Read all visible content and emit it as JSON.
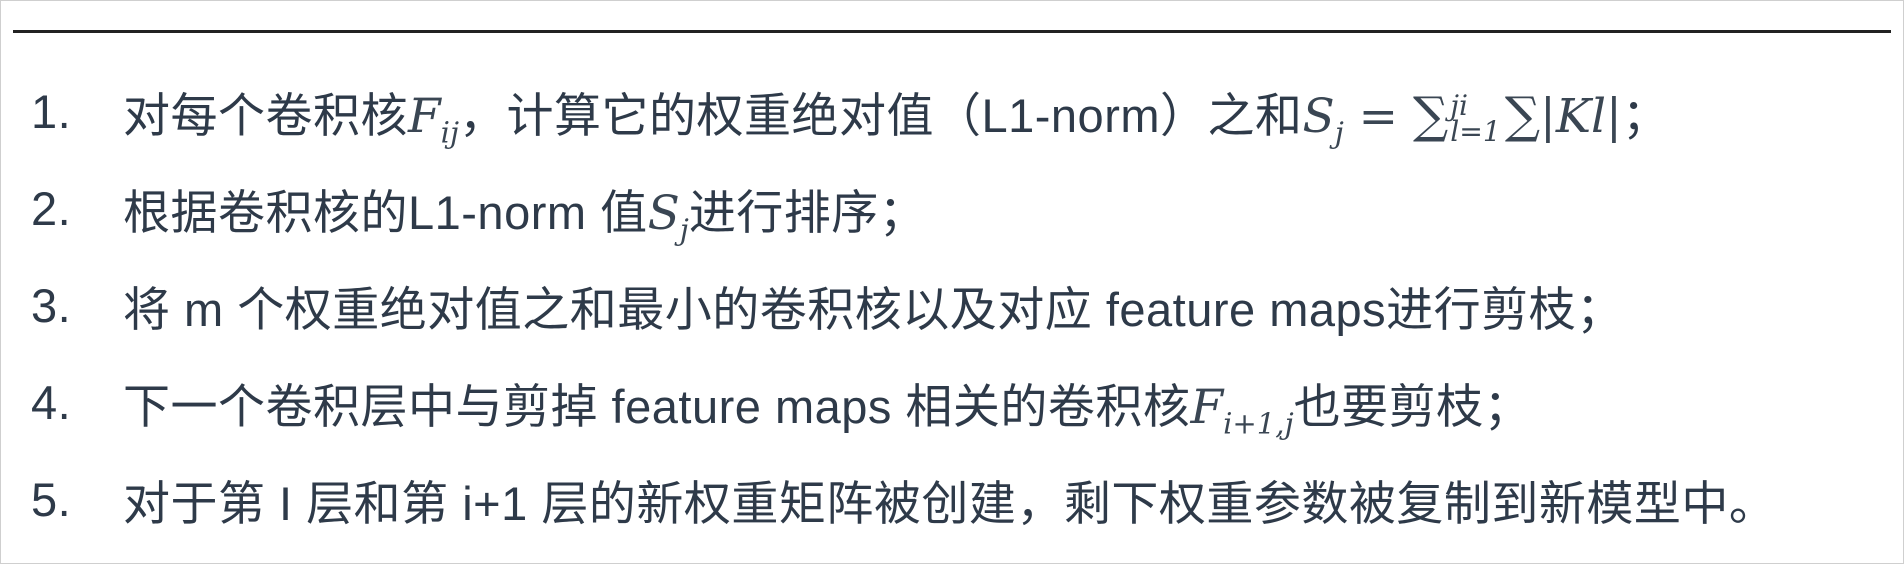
{
  "steps": [
    {
      "number": "1.",
      "text_a": "对每个卷积核 ",
      "math_F": "F",
      "math_F_sub": "ij",
      "text_b": "，计算它的权重绝对值（L1-norm）之和 ",
      "math_S": "S",
      "math_S_sub": "j",
      "eq": " = ",
      "sum1": "∑",
      "sum1_sup": "ji",
      "sum1_sub": "l=1",
      "sum2": "∑",
      "abs_expr": "|Kl|",
      "text_c": "；"
    },
    {
      "number": "2.",
      "text_a": "根据卷积核的L1-norm 值 ",
      "math_S": "S",
      "math_S_sub": "j",
      "text_b": " 进行排序；"
    },
    {
      "number": "3.",
      "text": "将 m 个权重绝对值之和最小的卷积核以及对应 feature maps进行剪枝；"
    },
    {
      "number": "4.",
      "text_a": "下一个卷积层中与剪掉 feature maps 相关的卷积核 ",
      "math_F": "F",
      "math_F_sub": "i+1,j",
      "text_b": " 也要剪枝；"
    },
    {
      "number": "5.",
      "text": "对于第 I 层和第 i+1 层的新权重矩阵被创建，剩下权重参数被复制到新模型中。"
    }
  ]
}
